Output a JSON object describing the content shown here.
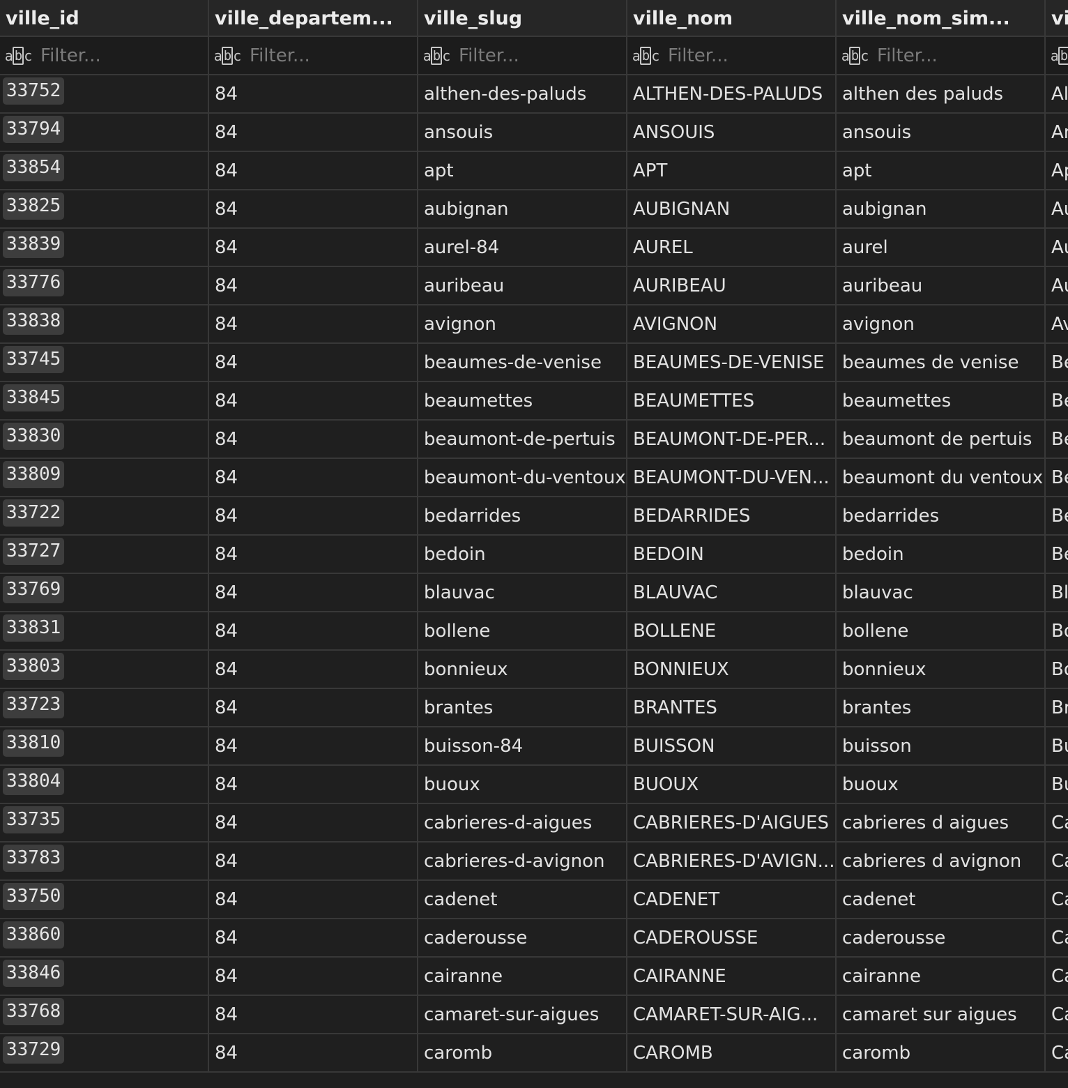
{
  "columns": [
    {
      "header": "ville_id",
      "filter_placeholder": "Filter..."
    },
    {
      "header": "ville_departem...",
      "filter_placeholder": "Filter..."
    },
    {
      "header": "ville_slug",
      "filter_placeholder": "Filter..."
    },
    {
      "header": "ville_nom",
      "filter_placeholder": "Filter..."
    },
    {
      "header": "ville_nom_sim...",
      "filter_placeholder": "Filter..."
    },
    {
      "header": "vi",
      "filter_placeholder": ""
    }
  ],
  "filter_icon_text": {
    "a": "a",
    "b": "b",
    "c": "c"
  },
  "rows": [
    {
      "id": "33752",
      "dep": "84",
      "slug": "althen-des-paluds",
      "nom": "ALTHEN-DES-PALUDS",
      "simple": "althen des paluds",
      "extra": "Al"
    },
    {
      "id": "33794",
      "dep": "84",
      "slug": "ansouis",
      "nom": "ANSOUIS",
      "simple": "ansouis",
      "extra": "An"
    },
    {
      "id": "33854",
      "dep": "84",
      "slug": "apt",
      "nom": "APT",
      "simple": "apt",
      "extra": "Ap"
    },
    {
      "id": "33825",
      "dep": "84",
      "slug": "aubignan",
      "nom": "AUBIGNAN",
      "simple": "aubignan",
      "extra": "Au"
    },
    {
      "id": "33839",
      "dep": "84",
      "slug": "aurel-84",
      "nom": "AUREL",
      "simple": "aurel",
      "extra": "Au"
    },
    {
      "id": "33776",
      "dep": "84",
      "slug": "auribeau",
      "nom": "AURIBEAU",
      "simple": "auribeau",
      "extra": "Au"
    },
    {
      "id": "33838",
      "dep": "84",
      "slug": "avignon",
      "nom": "AVIGNON",
      "simple": "avignon",
      "extra": "Av"
    },
    {
      "id": "33745",
      "dep": "84",
      "slug": "beaumes-de-venise",
      "nom": "BEAUMES-DE-VENISE",
      "simple": "beaumes de venise",
      "extra": "Be"
    },
    {
      "id": "33845",
      "dep": "84",
      "slug": "beaumettes",
      "nom": "BEAUMETTES",
      "simple": "beaumettes",
      "extra": "Be"
    },
    {
      "id": "33830",
      "dep": "84",
      "slug": "beaumont-de-pertuis",
      "nom": "BEAUMONT-DE-PER...",
      "simple": "beaumont de pertuis",
      "extra": "Be"
    },
    {
      "id": "33809",
      "dep": "84",
      "slug": "beaumont-du-ventoux",
      "nom": "BEAUMONT-DU-VEN...",
      "simple": "beaumont du ventoux",
      "extra": "Be"
    },
    {
      "id": "33722",
      "dep": "84",
      "slug": "bedarrides",
      "nom": "BEDARRIDES",
      "simple": "bedarrides",
      "extra": "Bé"
    },
    {
      "id": "33727",
      "dep": "84",
      "slug": "bedoin",
      "nom": "BEDOIN",
      "simple": "bedoin",
      "extra": "Bé"
    },
    {
      "id": "33769",
      "dep": "84",
      "slug": "blauvac",
      "nom": "BLAUVAC",
      "simple": "blauvac",
      "extra": "Bl"
    },
    {
      "id": "33831",
      "dep": "84",
      "slug": "bollene",
      "nom": "BOLLENE",
      "simple": "bollene",
      "extra": "Bo"
    },
    {
      "id": "33803",
      "dep": "84",
      "slug": "bonnieux",
      "nom": "BONNIEUX",
      "simple": "bonnieux",
      "extra": "Bo"
    },
    {
      "id": "33723",
      "dep": "84",
      "slug": "brantes",
      "nom": "BRANTES",
      "simple": "brantes",
      "extra": "Br"
    },
    {
      "id": "33810",
      "dep": "84",
      "slug": "buisson-84",
      "nom": "BUISSON",
      "simple": "buisson",
      "extra": "Bu"
    },
    {
      "id": "33804",
      "dep": "84",
      "slug": "buoux",
      "nom": "BUOUX",
      "simple": "buoux",
      "extra": "Bu"
    },
    {
      "id": "33735",
      "dep": "84",
      "slug": "cabrieres-d-aigues",
      "nom": "CABRIERES-D'AIGUES",
      "simple": "cabrieres d aigues",
      "extra": "Ca"
    },
    {
      "id": "33783",
      "dep": "84",
      "slug": "cabrieres-d-avignon",
      "nom": "CABRIERES-D'AVIGN...",
      "simple": "cabrieres d avignon",
      "extra": "Ca"
    },
    {
      "id": "33750",
      "dep": "84",
      "slug": "cadenet",
      "nom": "CADENET",
      "simple": "cadenet",
      "extra": "Ca"
    },
    {
      "id": "33860",
      "dep": "84",
      "slug": "caderousse",
      "nom": "CADEROUSSE",
      "simple": "caderousse",
      "extra": "Ca"
    },
    {
      "id": "33846",
      "dep": "84",
      "slug": "cairanne",
      "nom": "CAIRANNE",
      "simple": "cairanne",
      "extra": "Ca"
    },
    {
      "id": "33768",
      "dep": "84",
      "slug": "camaret-sur-aigues",
      "nom": "CAMARET-SUR-AIG...",
      "simple": "camaret sur aigues",
      "extra": "Ca"
    },
    {
      "id": "33729",
      "dep": "84",
      "slug": "caromb",
      "nom": "CAROMB",
      "simple": "caromb",
      "extra": "Ca"
    }
  ]
}
